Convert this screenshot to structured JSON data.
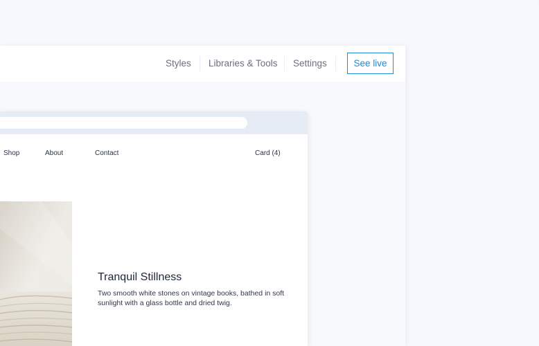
{
  "editor": {
    "nav": {
      "styles": "Styles",
      "libraries": "Libraries & Tools",
      "settings": "Settings"
    },
    "see_live": "See live"
  },
  "site": {
    "nav": {
      "shop": "Shop",
      "about": "About",
      "contact": "Contact",
      "cart": "Card (4)"
    },
    "product": {
      "title": "Tranquil Stillness",
      "description": "Two smooth white stones on vintage books, bathed in soft sunlight with a glass bottle and dried twig."
    }
  },
  "colors": {
    "accent": "#1f8ad8",
    "background": "#f7f8fd",
    "browser_chrome": "#e6ecf5"
  }
}
